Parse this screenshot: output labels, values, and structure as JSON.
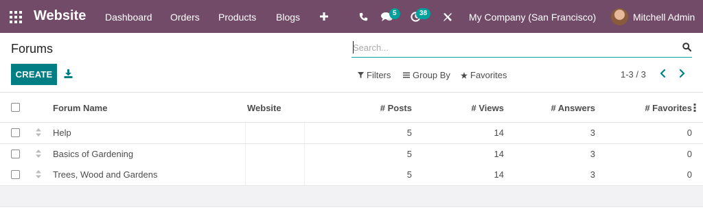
{
  "navbar": {
    "brand": "Website",
    "menu": [
      "Dashboard",
      "Orders",
      "Products",
      "Blogs"
    ],
    "messages_badge": "5",
    "activities_badge": "38",
    "company": "My Company (San Francisco)",
    "user": "Mitchell Admin",
    "color": "#714B67"
  },
  "control_panel": {
    "title": "Forums",
    "search_placeholder": "Search...",
    "create_label": "CREATE",
    "filters_label": "Filters",
    "group_by_label": "Group By",
    "favorites_label": "Favorites",
    "pager": "1-3 / 3"
  },
  "table": {
    "columns": [
      "Forum Name",
      "Website",
      "# Posts",
      "# Views",
      "# Answers",
      "# Favorites"
    ],
    "rows": [
      {
        "name": "Help",
        "website": "",
        "posts": "5",
        "views": "14",
        "answers": "3",
        "favorites": "0"
      },
      {
        "name": "Basics of Gardening",
        "website": "",
        "posts": "5",
        "views": "14",
        "answers": "3",
        "favorites": "0"
      },
      {
        "name": "Trees, Wood and Gardens",
        "website": "",
        "posts": "5",
        "views": "14",
        "answers": "3",
        "favorites": "0"
      }
    ]
  },
  "icons": {
    "apps": "apps-grid-icon",
    "add": "plus-icon",
    "call": "phone-icon",
    "messages": "chat-icon",
    "activities": "clock-icon",
    "debug": "tools-icon",
    "search": "search-icon",
    "download": "download-icon",
    "filter": "funnel-icon",
    "group_by": "list-icon",
    "favorites": "star-icon",
    "prev": "chevron-left-icon",
    "next": "chevron-right-icon",
    "optional_columns": "vertical-dots-icon",
    "drag": "drag-handle-icon"
  },
  "colors": {
    "primary": "#017E84",
    "badge": "#00A09D",
    "search_underline": "#00A09D"
  }
}
